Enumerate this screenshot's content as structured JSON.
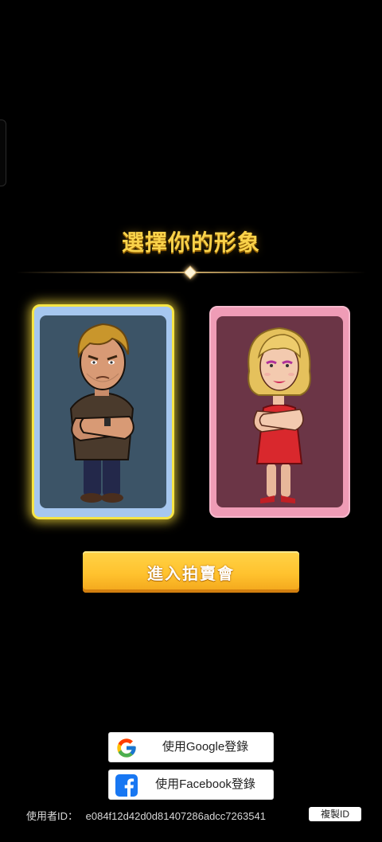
{
  "title": "選擇你的形象",
  "characters": [
    {
      "id": "male",
      "selected": true
    },
    {
      "id": "female",
      "selected": false
    }
  ],
  "enter_button": "進入拍賣會",
  "login": {
    "google_label": "使用Google登錄",
    "google_icon": "google-icon",
    "facebook_label": "使用Facebook登錄",
    "facebook_icon": "facebook-icon"
  },
  "user": {
    "id_label": "使用者ID：",
    "id_value": "e084f12d42d0d81407286adcc7263541",
    "copy_button": "複製ID"
  },
  "colors": {
    "title": "#f9d24a",
    "selected_border": "#f6e545",
    "male_card": "#a6c7ef",
    "female_card": "#ef9cb6",
    "button": "#ffc22e"
  }
}
